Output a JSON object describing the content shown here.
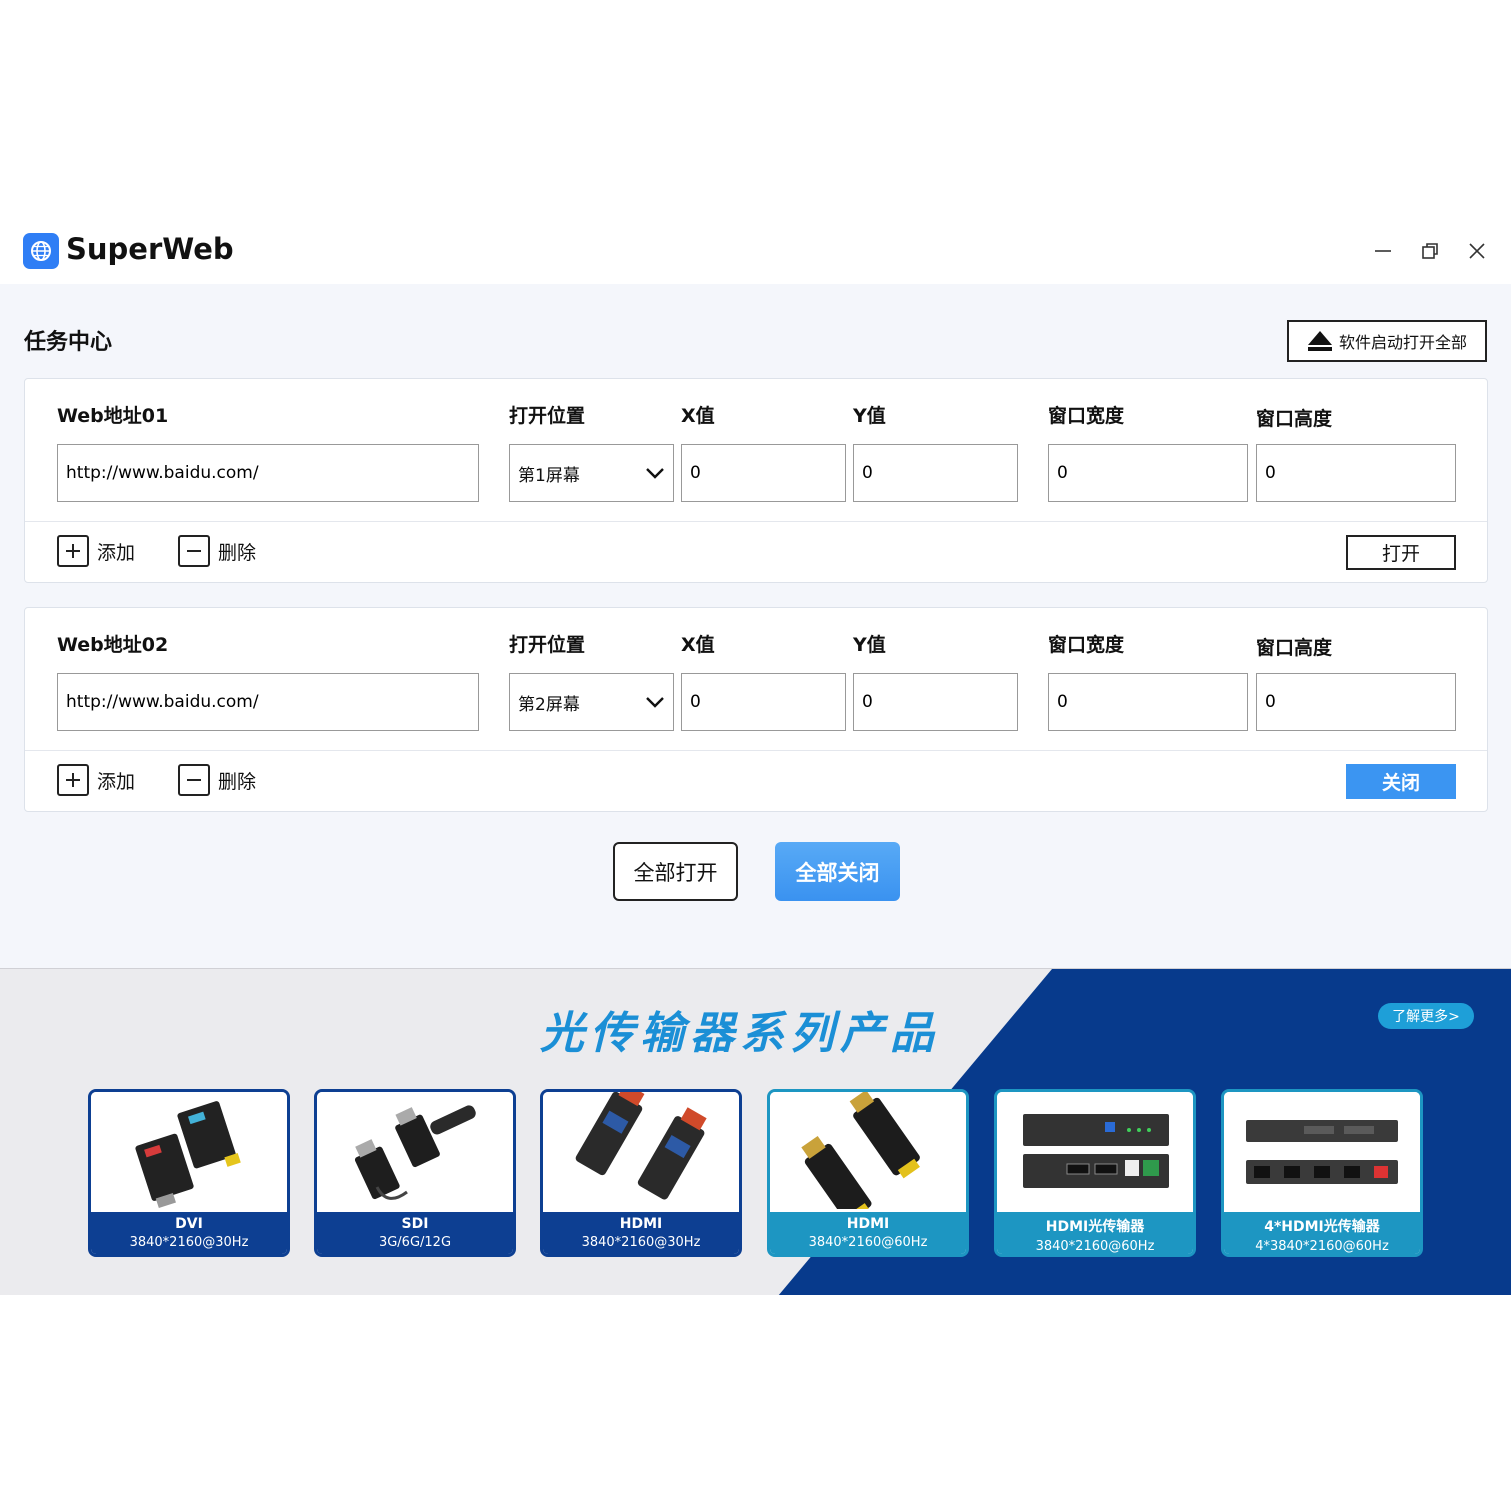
{
  "app": {
    "title": "SuperWeb"
  },
  "page": {
    "title": "任务中心",
    "start_all_label": "软件启动打开全部"
  },
  "labels": {
    "x": "X值",
    "y": "Y值",
    "width": "窗口宽度",
    "height": "窗口高度",
    "position": "打开位置",
    "add": "添加",
    "delete": "删除"
  },
  "tasks": [
    {
      "name": "Web地址01",
      "url": "http://www.baidu.com/",
      "position": "第1屏幕",
      "x": "0",
      "y": "0",
      "width": "0",
      "height": "0",
      "action": "打开"
    },
    {
      "name": "Web地址02",
      "url": "http://www.baidu.com/",
      "position": "第2屏幕",
      "x": "0",
      "y": "0",
      "width": "0",
      "height": "0",
      "action": "关闭"
    }
  ],
  "footer": {
    "open_all": "全部打开",
    "close_all": "全部关闭"
  },
  "banner": {
    "title": "光传输器系列产品",
    "more": "了解更多>",
    "products": [
      {
        "name": "DVI",
        "spec": "3840*2160@30Hz"
      },
      {
        "name": "SDI",
        "spec": "3G/6G/12G"
      },
      {
        "name": "HDMI",
        "spec": "3840*2160@30Hz"
      },
      {
        "name": "HDMI",
        "spec": "3840*2160@60Hz"
      },
      {
        "name": "HDMI光传输器",
        "spec": "3840*2160@60Hz"
      },
      {
        "name": "4*HDMI光传输器",
        "spec": "4*3840*2160@60Hz"
      }
    ]
  },
  "colors": {
    "accent": "#3b95f2",
    "banner_dark": "#073a8c",
    "banner_light": "#ebebee",
    "caption_dark": "#0d3f92",
    "caption_teal": "#1d96c2"
  }
}
